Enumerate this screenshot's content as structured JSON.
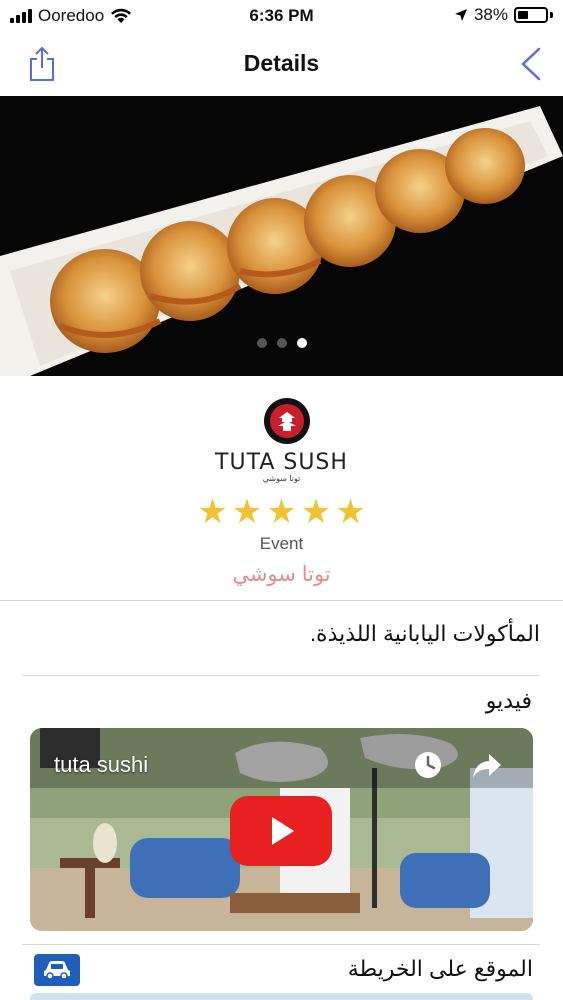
{
  "status_bar": {
    "carrier": "Ooredoo",
    "time": "6:36 PM",
    "battery": "38%",
    "battery_level": 0.38
  },
  "nav": {
    "title": "Details"
  },
  "gallery": {
    "page_count": 3,
    "active_page": 3
  },
  "venue": {
    "logo_text": "TUTA SUSH",
    "logo_subtitle": "توتا سوشي",
    "rating": 5,
    "star_glyph": "★",
    "type": "Event",
    "name_arabic": "توتا سوشي",
    "description": "المأكولات اليابانية اللذيذة."
  },
  "video_section": {
    "label": "فيديو",
    "video_title": "tuta sushi"
  },
  "map_section": {
    "label": "الموقع على الخريطة"
  },
  "colors": {
    "accent": "#5a6fd6",
    "star": "#f1c232",
    "name_pink": "#e48a8a",
    "youtube_red": "#e6211f",
    "car_blue": "#1f5fb8"
  },
  "icons": {
    "share": "share-icon",
    "back": "chevron-left-icon",
    "play": "play-icon",
    "clock": "clock-icon",
    "forward": "share-arrow-icon",
    "car": "car-icon"
  }
}
